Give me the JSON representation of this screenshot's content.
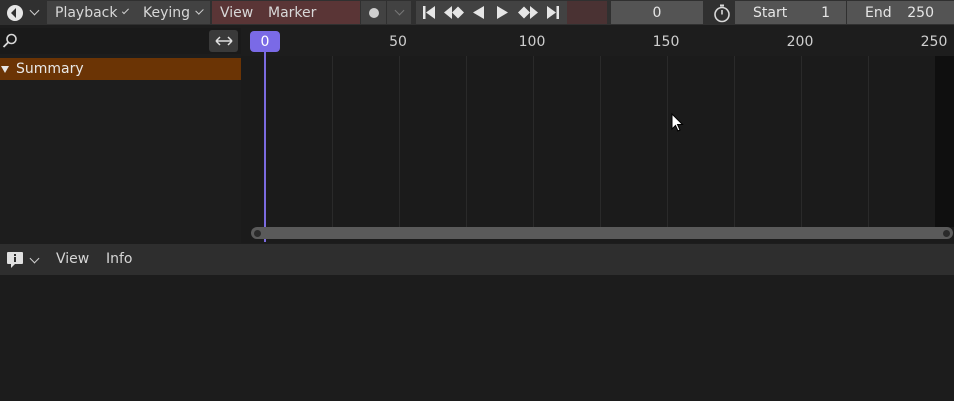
{
  "header": {
    "menus": [
      "Playback",
      "Keying"
    ],
    "view_label": "View",
    "marker_label": "Marker",
    "current_frame": "0",
    "start_label": "Start",
    "start_value": "1",
    "end_label": "End",
    "end_value": "250"
  },
  "channels": {
    "summary_label": "Summary"
  },
  "timeline": {
    "playhead_frame": "0",
    "ruler_ticks": [
      "50",
      "100",
      "150",
      "200",
      "250"
    ]
  },
  "info_editor": {
    "view_label": "View",
    "info_label": "Info"
  },
  "colors": {
    "playhead": "#7a6ae6",
    "summary_row": "#6b3405",
    "header_red": "#4a3233"
  }
}
